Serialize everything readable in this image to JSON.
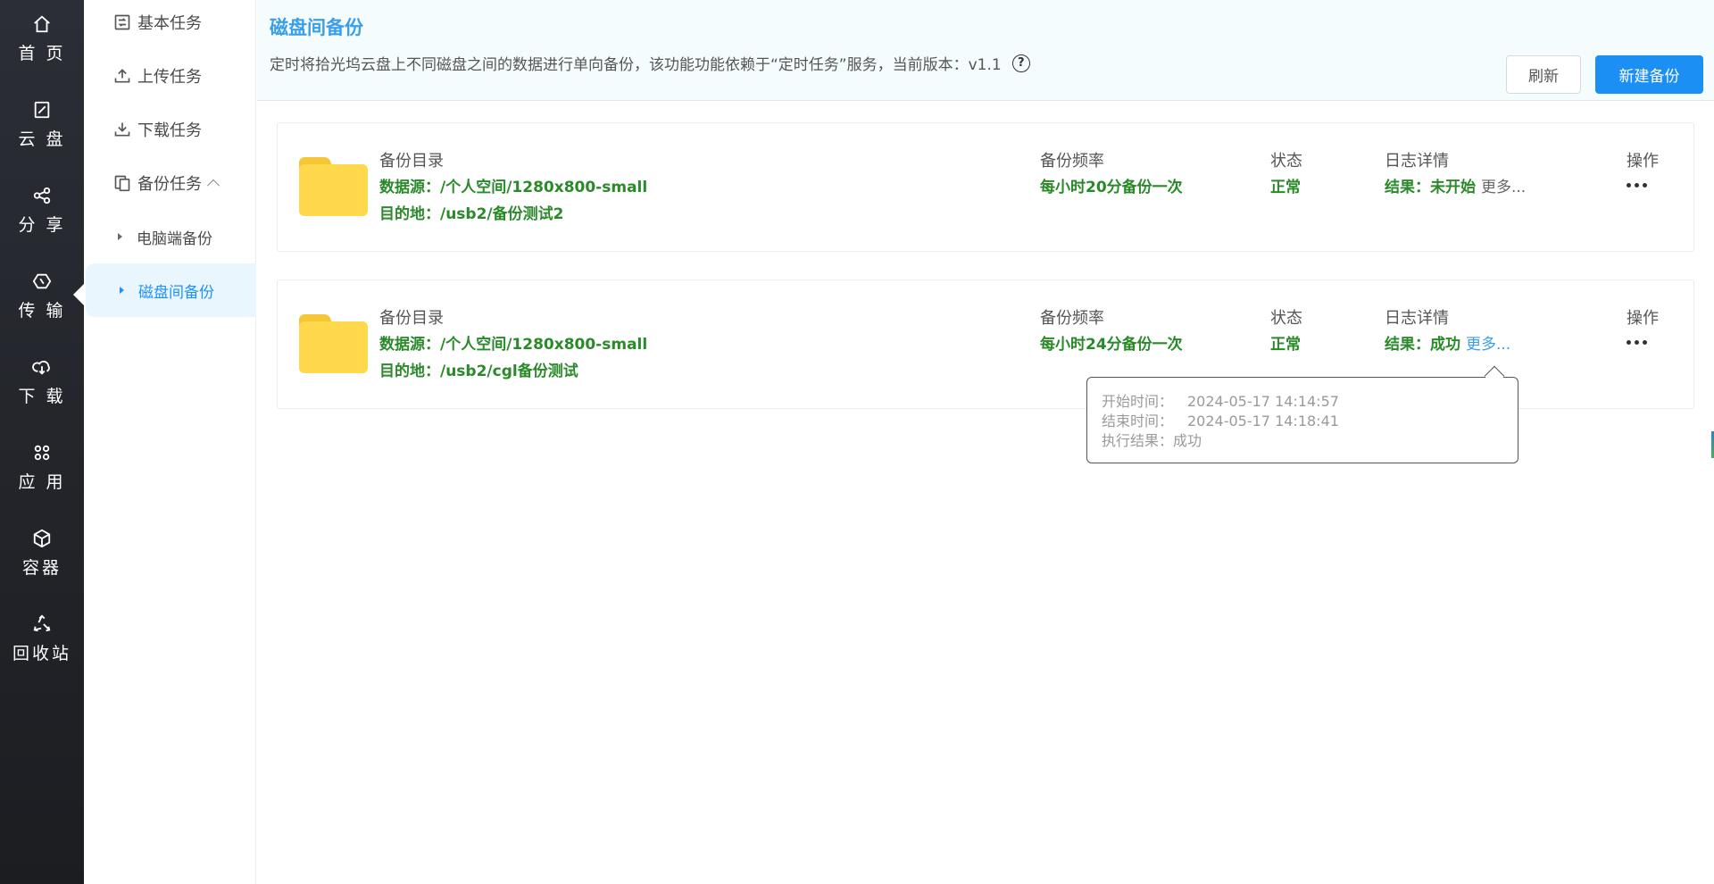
{
  "rail": {
    "items": [
      {
        "key": "home",
        "label": "首 页",
        "icon": "home-icon"
      },
      {
        "key": "cloud",
        "label": "云 盘",
        "icon": "cloud-disk-icon"
      },
      {
        "key": "share",
        "label": "分 享",
        "icon": "share-icon"
      },
      {
        "key": "transfer",
        "label": "传 输",
        "icon": "transfer-icon"
      },
      {
        "key": "download",
        "label": "下 载",
        "icon": "download-cloud-icon"
      },
      {
        "key": "apps",
        "label": "应 用",
        "icon": "apps-icon"
      },
      {
        "key": "container",
        "label": "容器",
        "icon": "container-icon"
      },
      {
        "key": "recycle",
        "label": "回收站",
        "icon": "recycle-icon"
      }
    ],
    "active": "transfer"
  },
  "subnav": {
    "basic": "基本任务",
    "upload": "上传任务",
    "download": "下载任务",
    "backup": "备份任务",
    "pc_backup": "电脑端备份",
    "disk_backup": "磁盘间备份"
  },
  "header": {
    "title": "磁盘间备份",
    "description": "定时将拾光坞云盘上不同磁盘之间的数据进行单向备份，该功能功能依赖于“定时任务”服务，当前版本：v1.1",
    "help": "?",
    "refresh_label": "刷新",
    "new_label": "新建备份"
  },
  "columns": {
    "dir": "备份目录",
    "freq": "备份频率",
    "status": "状态",
    "log": "日志详情",
    "ops": "操作"
  },
  "tasks": [
    {
      "source": "数据源：/个人空间/1280x800-small",
      "dest": "目的地：/usb2/备份测试2",
      "freq": "每小时20分备份一次",
      "status": "正常",
      "result": "结果：未开始",
      "more": "更多..."
    },
    {
      "source": "数据源：/个人空间/1280x800-small",
      "dest": "目的地：/usb2/cgl备份测试",
      "freq": "每小时24分备份一次",
      "status": "正常",
      "result": "结果：成功",
      "more": "更多..."
    }
  ],
  "tooltip": {
    "start_key": "开始时间：",
    "start_val": "2024-05-17 14:14:57",
    "end_key": "结束时间：",
    "end_val": "2024-05-17 14:18:41",
    "result_key": "执行结果：",
    "result_val": "成功"
  },
  "colors": {
    "accent": "#1c8ff5",
    "title_blue": "#3a9fe8",
    "green": "#2a8a2a",
    "rail_bg": "#25272d"
  }
}
